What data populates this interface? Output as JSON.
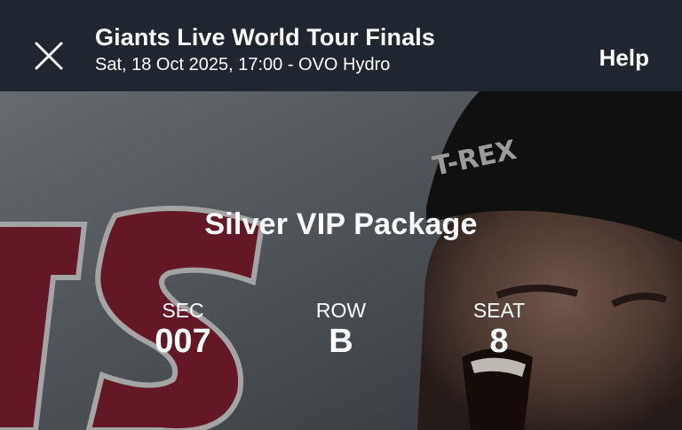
{
  "header": {
    "close_icon": "close-icon",
    "title": "Giants Live World Tour Finals",
    "subtitle": "Sat, 18 Oct 2025, 17:00 - OVO Hydro",
    "help_label": "Help"
  },
  "hero": {
    "package_name": "Silver VIP Package",
    "headband_text": "T-REX",
    "logo_letters": "TS",
    "seats": [
      {
        "label": "SEC",
        "value": "007"
      },
      {
        "label": "ROW",
        "value": "B"
      },
      {
        "label": "SEAT",
        "value": "8"
      }
    ]
  },
  "colors": {
    "header_bg": "#1f2630",
    "logo_maroon": "#7a1e2e",
    "text": "#ffffff"
  }
}
